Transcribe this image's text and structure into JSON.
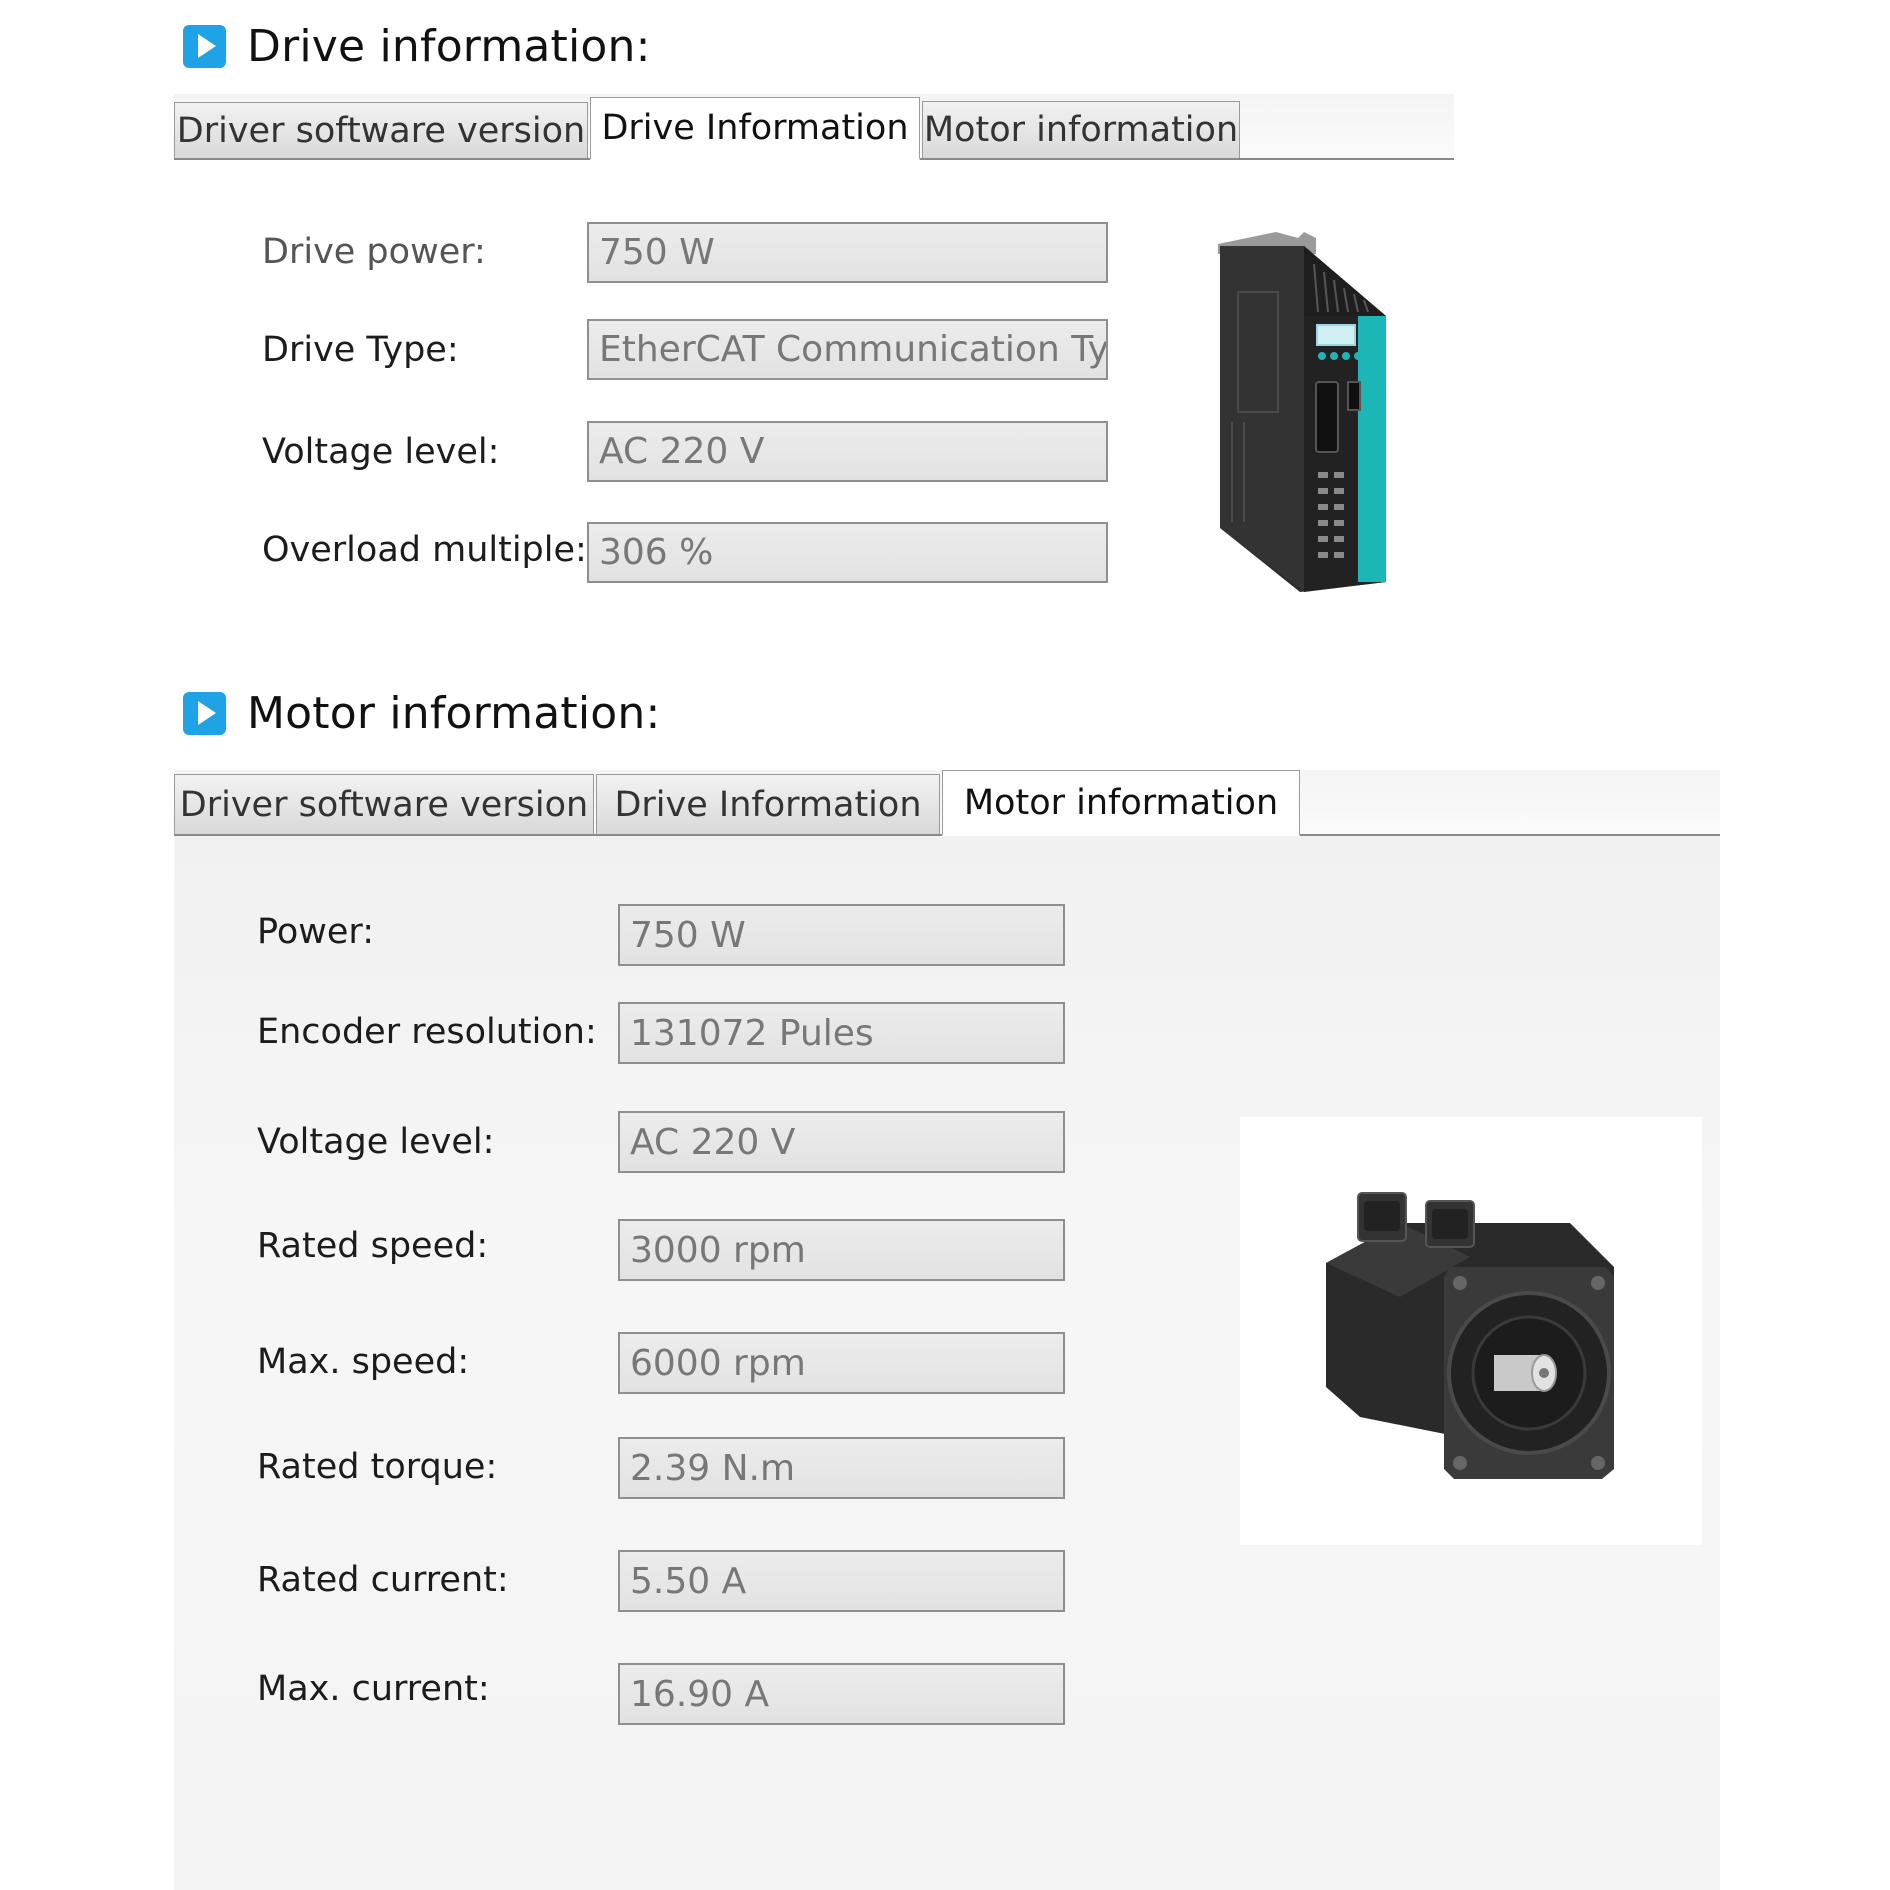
{
  "drive_section": {
    "title": "Drive information:",
    "tabs": [
      "Driver software version",
      "Drive Information",
      "Motor information"
    ],
    "fields": [
      {
        "label": "Drive power:",
        "value": "750 W"
      },
      {
        "label": "Drive Type:",
        "value": "EtherCAT Communication Ty..."
      },
      {
        "label": "Voltage level:",
        "value": "AC 220 V"
      },
      {
        "label": "Overload multiple:",
        "value": "306 %"
      }
    ]
  },
  "motor_section": {
    "title": "Motor information:",
    "tabs": [
      "Driver software version",
      "Drive Information",
      "Motor information"
    ],
    "fields": [
      {
        "label": "Power:",
        "value": "750 W"
      },
      {
        "label": "Encoder resolution:",
        "value": "131072 Pules"
      },
      {
        "label": "Voltage level:",
        "value": "AC 220 V"
      },
      {
        "label": "Rated speed:",
        "value": "3000 rpm"
      },
      {
        "label": "Max. speed:",
        "value": "6000 rpm"
      },
      {
        "label": "Rated torque:",
        "value": "2.39 N.m"
      },
      {
        "label": "Rated current:",
        "value": "5.50 A"
      },
      {
        "label": "Max. current:",
        "value": "16.90 A"
      }
    ]
  },
  "colors": {
    "accent": "#1fa3e6",
    "drive_teal": "#1bb6b6"
  }
}
